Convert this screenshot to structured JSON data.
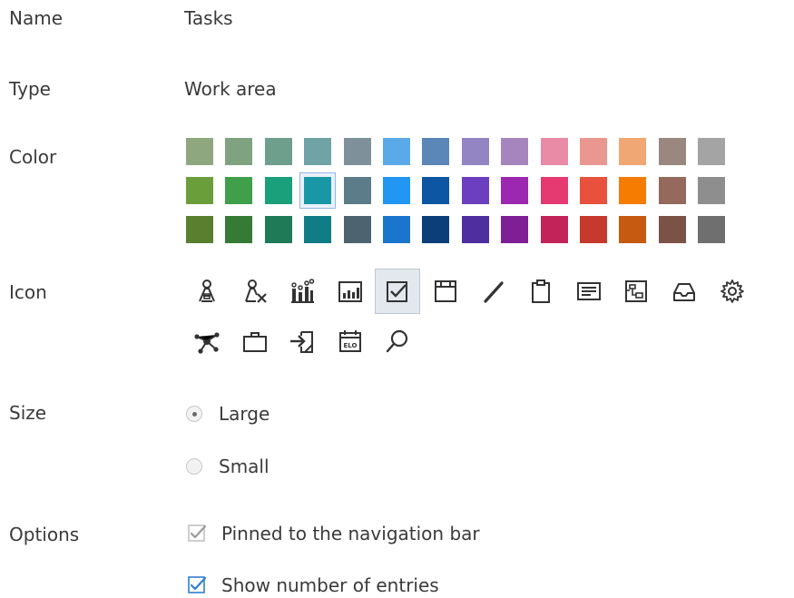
{
  "fields": {
    "name_label": "Name",
    "name_value": "Tasks",
    "type_label": "Type",
    "type_value": "Work area",
    "color_label": "Color",
    "icon_label": "Icon",
    "size_label": "Size",
    "options_label": "Options"
  },
  "palette": {
    "rows": [
      [
        "#8fa77e",
        "#7fa381",
        "#6e9f8c",
        "#6fa3a5",
        "#7e919a",
        "#5aa9e8",
        "#5a86b8",
        "#9385c3",
        "#a685bf",
        "#e98aa6",
        "#e9978f",
        "#f0a773",
        "#9a8880",
        "#a4a4a4"
      ],
      [
        "#6a9e3a",
        "#3f9f4a",
        "#1aa07a",
        "#1898a6",
        "#5d7c8a",
        "#2196f3",
        "#0d56a3",
        "#6b3fc0",
        "#9c27b0",
        "#e53972",
        "#e8523c",
        "#f57c00",
        "#95695c",
        "#8e8e8e"
      ],
      [
        "#5a7f2f",
        "#357a35",
        "#1f7a58",
        "#107c86",
        "#4d6470",
        "#1a76cc",
        "#0c3f7a",
        "#4f2ea0",
        "#7e1f96",
        "#c2245a",
        "#c53a2c",
        "#c55a10",
        "#7a5346",
        "#6f6f6f"
      ]
    ],
    "selected": {
      "row": 1,
      "col": 3
    }
  },
  "icons": {
    "row1": [
      "user-folder-icon",
      "user-remove-icon",
      "bar-chart-icon",
      "report-chart-icon",
      "checkbox-task-icon",
      "window-icon",
      "pencil-icon",
      "clipboard-icon",
      "message-list-icon",
      "diagram-icon",
      "inbox-tray-icon",
      "gear-icon"
    ],
    "row2": [
      "network-icon",
      "briefcase-icon",
      "sign-in-icon",
      "elo-calendar-icon",
      "search-icon"
    ],
    "selected": "checkbox-task-icon",
    "elo_text": "ELO"
  },
  "size": {
    "options": [
      {
        "label": "Large",
        "checked": true
      },
      {
        "label": "Small",
        "checked": false
      }
    ]
  },
  "options": {
    "items": [
      {
        "label": "Pinned to the navigation bar",
        "checked": true,
        "enabled": false
      },
      {
        "label": "Show number of entries",
        "checked": true,
        "enabled": true
      }
    ]
  },
  "colors": {
    "text": "#3a3a3a",
    "icon": "#333333",
    "checkbox_enabled": "#2f7fd1",
    "checkbox_disabled": "#9a9a9a",
    "selection_highlight": "#e3e8ee"
  }
}
